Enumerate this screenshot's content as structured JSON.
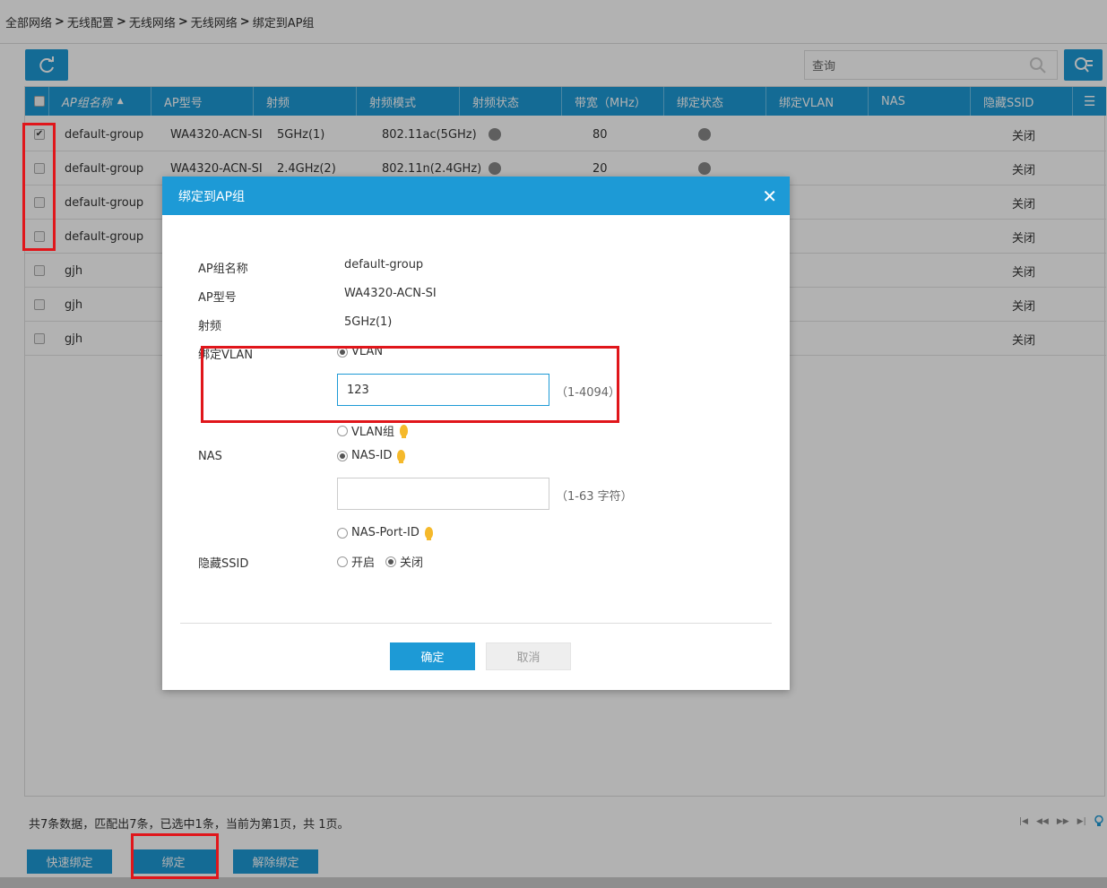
{
  "breadcrumb": [
    "全部网络",
    "无线配置",
    "无线网络",
    "无线网络",
    "绑定到AP组"
  ],
  "search": {
    "placeholder": "查询"
  },
  "table": {
    "columns": [
      "AP组名称",
      "AP型号",
      "射频",
      "射频模式",
      "射频状态",
      "带宽（MHz）",
      "绑定状态",
      "绑定VLAN",
      "NAS",
      "隐藏SSID"
    ],
    "rows": [
      {
        "checked": true,
        "group": "default-group",
        "model": "WA4320-ACN-SI",
        "radio": "5GHz(1)",
        "mode": "802.11ac(5GHz)",
        "bandwidth": "80",
        "hidden_ssid": "关闭"
      },
      {
        "checked": false,
        "group": "default-group",
        "model": "WA4320-ACN-SI",
        "radio": "2.4GHz(2)",
        "mode": "802.11n(2.4GHz)",
        "bandwidth": "20",
        "hidden_ssid": "关闭"
      },
      {
        "checked": false,
        "group": "default-group",
        "model": "",
        "radio": "",
        "mode": "",
        "bandwidth": "",
        "hidden_ssid": "关闭"
      },
      {
        "checked": false,
        "group": "default-group",
        "model": "",
        "radio": "",
        "mode": "",
        "bandwidth": "",
        "hidden_ssid": "关闭"
      },
      {
        "checked": false,
        "group": "gjh",
        "model": "",
        "radio": "",
        "mode": "",
        "bandwidth": "",
        "hidden_ssid": "关闭"
      },
      {
        "checked": false,
        "group": "gjh",
        "model": "",
        "radio": "",
        "mode": "",
        "bandwidth": "",
        "hidden_ssid": "关闭"
      },
      {
        "checked": false,
        "group": "gjh",
        "model": "",
        "radio": "",
        "mode": "",
        "bandwidth": "",
        "hidden_ssid": "关闭"
      }
    ]
  },
  "footer": {
    "summary": "共7条数据，匹配出7条，已选中1条，当前为第1页，共 1页。",
    "buttons": {
      "quick_bind": "快速绑定",
      "bind": "绑定",
      "unbind": "解除绑定"
    }
  },
  "dialog": {
    "title": "绑定到AP组",
    "close_glyph": "✕",
    "fields": {
      "group_label": "AP组名称",
      "group_value": "default-group",
      "model_label": "AP型号",
      "model_value": "WA4320-ACN-SI",
      "radio_label": "射频",
      "radio_value": "5GHz(1)",
      "vlan_label": "绑定VLAN",
      "vlan_option": "VLAN",
      "vlan_value": "123",
      "vlan_hint": "（1-4094）",
      "vlan_group_option": "VLAN组",
      "nas_label": "NAS",
      "nas_id_option": "NAS-ID",
      "nas_id_value": "",
      "nas_hint": "（1-63 字符）",
      "nas_port_option": "NAS-Port-ID",
      "hidden_label": "隐藏SSID",
      "hidden_on": "开启",
      "hidden_off": "关闭"
    },
    "buttons": {
      "ok": "确定",
      "cancel": "取消"
    }
  },
  "colors": {
    "accent": "#1d9ad6",
    "highlight": "#e0161b"
  }
}
